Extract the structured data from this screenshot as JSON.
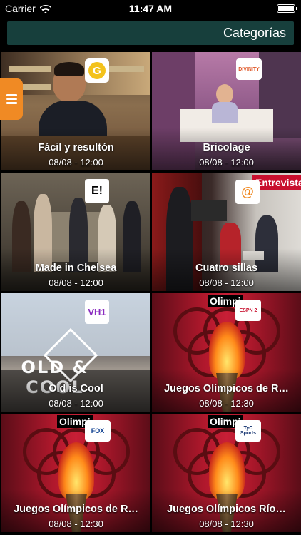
{
  "status": {
    "carrier": "Carrier",
    "time": "11:47 AM"
  },
  "header": {
    "title": "Categorías"
  },
  "tiles": [
    {
      "title": "Fácil y resultón",
      "time": "08/08 - 12:00",
      "channel_logo": "G"
    },
    {
      "title": "Bricolage",
      "time": "08/08 - 12:00",
      "channel_logo": "DIVINITY"
    },
    {
      "title": "Made in Chelsea",
      "time": "08/08 - 12:00",
      "channel_logo": "E!"
    },
    {
      "title": "Cuatro sillas",
      "time": "08/08 - 12:00",
      "channel_logo": "@",
      "banner": "Entrevista"
    },
    {
      "title": "Old is Cool",
      "time": "08/08 - 12:00",
      "channel_logo": "VH1",
      "art_text": "OLD & COOL"
    },
    {
      "title": "Juegos Olímpicos de R…",
      "time": "08/08 - 12:30",
      "channel_logo": "ESPN 2",
      "banner": "Olimpi"
    },
    {
      "title": "Juegos Olímpicos de R…",
      "time": "08/08 - 12:30",
      "channel_logo": "FOX",
      "banner": "Olimpi"
    },
    {
      "title": "Juegos Olímpicos Río…",
      "time": "08/08 - 12:30",
      "channel_logo": "TyC Sports",
      "banner": "Olimpi"
    }
  ],
  "colors": {
    "header_bg": "#173f3c",
    "menu_tab": "#f08a24",
    "olympic_red": "#b0182c"
  },
  "icons": {
    "menu": "hamburger-icon",
    "wifi": "wifi-icon",
    "battery": "battery-icon"
  }
}
